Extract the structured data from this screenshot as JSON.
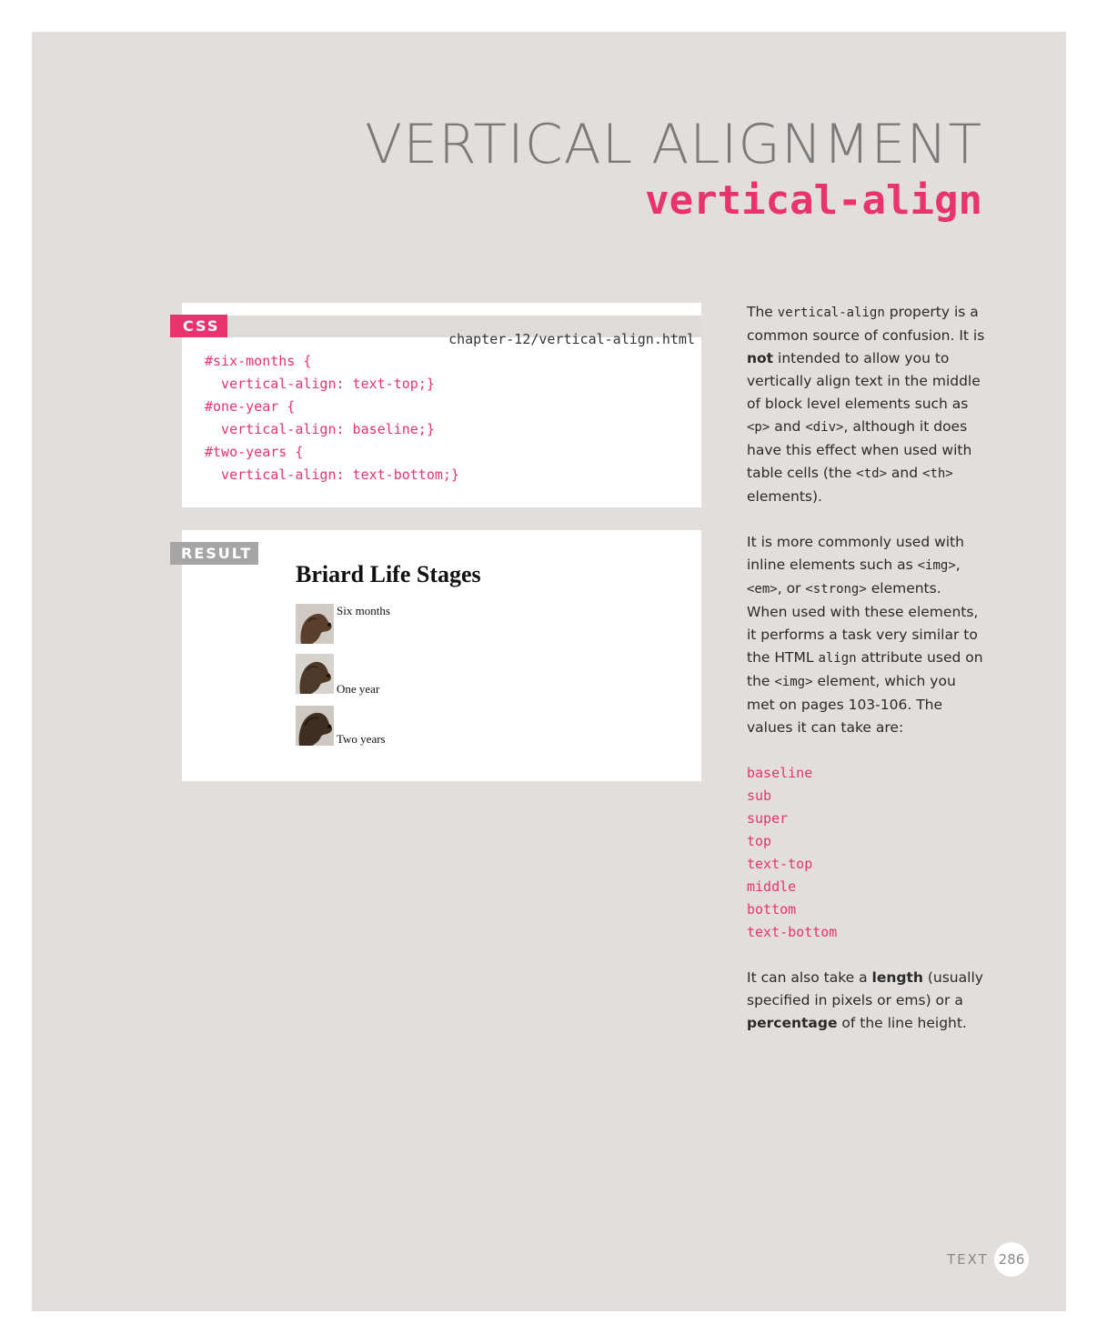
{
  "heading": {
    "title": "VERTICAL ALIGNMENT",
    "subtitle": "vertical-align"
  },
  "css_panel": {
    "tag": "CSS",
    "filename": "chapter-12/vertical-align.html",
    "code_lines": [
      "#six-months {",
      "  vertical-align: text-top;}",
      "#one-year {",
      "  vertical-align: baseline;}",
      "#two-years {",
      "  vertical-align: text-bottom;}"
    ]
  },
  "result_panel": {
    "tag": "RESULT",
    "heading": "Briard Life Stages",
    "stages": [
      {
        "label": "Six months",
        "image": "dog-photo"
      },
      {
        "label": "One year",
        "image": "dog-photo"
      },
      {
        "label": "Two years",
        "image": "dog-photo"
      }
    ]
  },
  "sidebar": {
    "p1": {
      "t1": "The ",
      "code1": "vertical-align",
      "t2": " property is a common source of confusion. It is ",
      "bold1": "not",
      "t3": " intended to allow you to vertically align text in the middle of block level elements such as ",
      "code2": "<p>",
      "t4": " and ",
      "code3": "<div>",
      "t5": ", although it does have this effect when used with table cells (the ",
      "code4": "<td>",
      "t6": " and ",
      "code5": "<th>",
      "t7": " elements)."
    },
    "p2": {
      "t1": "It is more commonly used with inline elements such as ",
      "code1": "<img>",
      "t2": ", ",
      "code2": "<em>",
      "t3": ", or ",
      "code3": "<strong>",
      "t4": " elements. When used with these elements, it performs a task very similar to the HTML ",
      "code4": "align",
      "t5": " attribute used on the ",
      "code5": "<img>",
      "t6": " element, which you met on pages 103-106. The values it can take are:"
    },
    "values": [
      "baseline",
      "sub",
      "super",
      "top",
      "text-top",
      "middle",
      "bottom",
      "text-bottom"
    ],
    "p3": {
      "t1": "It can also take a ",
      "bold1": "length",
      "t2": " (usually specified in pixels or ems) or a ",
      "bold2": "percentage",
      "t3": " of the line height."
    }
  },
  "footer": {
    "section": "TEXT",
    "page": "286"
  }
}
